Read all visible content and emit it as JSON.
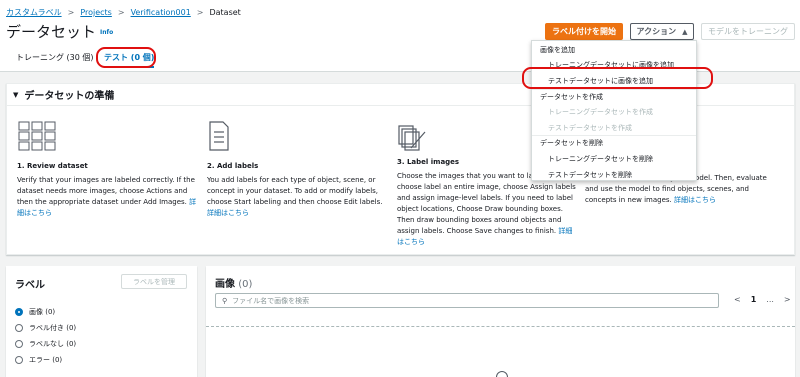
{
  "breadcrumb": {
    "items": [
      "カスタムラベル",
      "Projects",
      "Verification001",
      "Dataset"
    ],
    "separator": ">"
  },
  "header": {
    "title": "データセット",
    "info": "Info",
    "start_labeling": "ラベル付けを開始",
    "actions": "アクション",
    "train_model": "モデルをトレーニング"
  },
  "tabs": [
    {
      "label": "トレーニング (30 個)"
    },
    {
      "label": "テスト (0 個)"
    }
  ],
  "prep": {
    "title": "データセットの準備",
    "steps": [
      {
        "title": "1. Review dataset",
        "desc": "Verify that your images are labeled correctly. If the dataset needs more images, choose Actions and then the appropriate dataset under Add Images.",
        "more": "詳細はこちら"
      },
      {
        "title": "2. Add labels",
        "desc": "You add labels for each type of object, scene, or concept in your dataset. To add or modify labels, choose Start labeling and then choose Edit labels.",
        "more": "詳細はこちら"
      },
      {
        "title": "3. Label images",
        "desc": "Choose the images that you want to label and then choose label an entire image, choose Assign labels and assign image-level labels. If you need to label object locations, Choose Draw bounding boxes. Then draw bounding boxes around objects and assign labels. Choose Save changes to finish.",
        "more": "詳細はこちら"
      },
      {
        "title": "",
        "desc": "ose Train model to train your model. Then, evaluate and use the model to find objects, scenes, and concepts in new images.",
        "more": "詳細はこちら"
      }
    ]
  },
  "labels": {
    "title": "ラベル",
    "manage": "ラベルを管理",
    "filters": [
      {
        "label": "画像",
        "count": "(0)",
        "selected": true
      },
      {
        "label": "ラベル付き",
        "count": "(0)",
        "selected": false
      },
      {
        "label": "ラベルなし",
        "count": "(0)",
        "selected": false
      },
      {
        "label": "エラー",
        "count": "(0)",
        "selected": false
      }
    ]
  },
  "images": {
    "title": "画像",
    "count": "(0)",
    "search_placeholder": "ファイル名で画像を検索",
    "pager": {
      "prev": "<",
      "page": "1",
      "ellipsis": "...",
      "next": ">"
    }
  },
  "actions_menu": {
    "groups": [
      {
        "title": "画像を追加",
        "items": [
          {
            "label": "トレーニングデータセットに画像を追加",
            "enabled": true
          },
          {
            "label": "テストデータセットに画像を追加",
            "enabled": true
          }
        ]
      },
      {
        "title": "データセットを作成",
        "items": [
          {
            "label": "トレーニングデータセットを作成",
            "enabled": false
          },
          {
            "label": "テストデータセットを作成",
            "enabled": false
          }
        ]
      },
      {
        "title": "データセットを削除",
        "items": [
          {
            "label": "トレーニングデータセットを削除",
            "enabled": true
          },
          {
            "label": "テストデータセットを削除",
            "enabled": true
          }
        ]
      }
    ]
  },
  "colors": {
    "link": "#0073bb",
    "primary": "#ec7211",
    "highlight": "#e01010"
  },
  "icons": [
    "image-grid-icon",
    "label-list-icon",
    "draw-images-icon",
    "caret-down-icon",
    "search-icon",
    "dropdown-arrow-icon"
  ]
}
